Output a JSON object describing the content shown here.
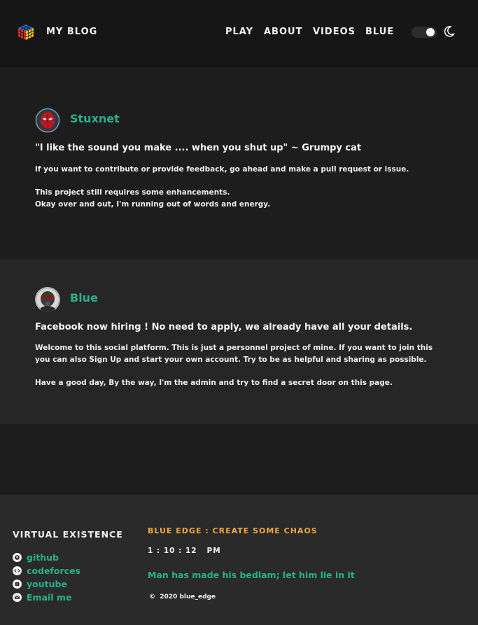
{
  "header": {
    "brand": "MY BLOG",
    "nav": [
      "PLAY",
      "ABOUT",
      "VIDEOS",
      "BLUE"
    ],
    "theme_toggle_on": true
  },
  "posts": [
    {
      "author": "Stuxnet",
      "headline": "\"I like the sound you make .... when you shut up\" ~ Grumpy cat",
      "paragraphs": [
        "If you want to contribute or provide feedback, go ahead and make a pull request or issue.",
        "This project still requires some enhancements.",
        "Okay over and out, I'm running out of words and energy."
      ]
    },
    {
      "author": "Blue",
      "headline": "Facebook now hiring ! No need to apply, we already have all your details.",
      "paragraphs": [
        "Welcome to this social platform. This is just a personnel project of mine. If you want to join this you can also Sign Up and start your own account. Try to be as helpful and sharing as possible.",
        "Have a good day, By the way, I'm the admin and try to find a secret door on this page."
      ]
    }
  ],
  "footer": {
    "title": "VIRTUAL EXISTENCE",
    "links": [
      "github",
      "codeforces",
      "youtube",
      "Email me"
    ],
    "tagline": "BLUE EDGE : CREATE SOME CHAOS",
    "time": "1 : 10 : 12   PM",
    "quote": "Man has made his bedlam; let him lie in it",
    "copyright": "©  2020 blue_edge"
  },
  "colors": {
    "accent": "#28b08a",
    "orange": "#f3a63a",
    "header_bg": "#161616",
    "page_bg": "#1d1d1d",
    "post_alt_bg": "#262626",
    "footer_bg": "#2a2a2a"
  }
}
